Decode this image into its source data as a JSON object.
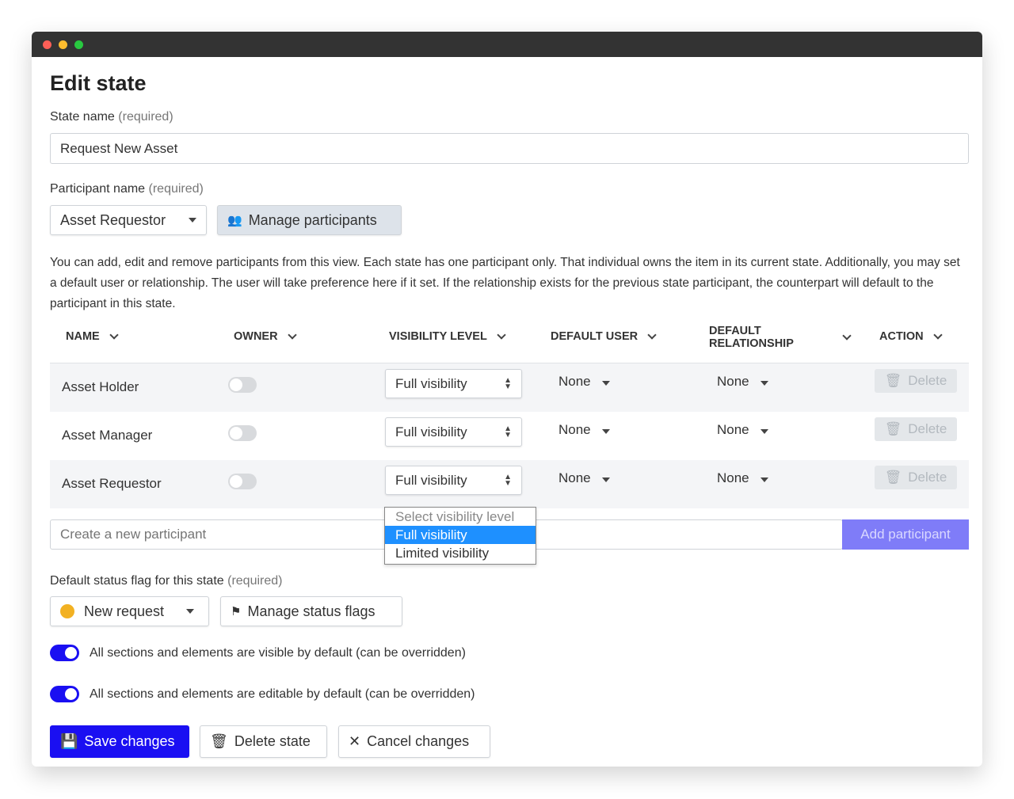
{
  "title": "Edit state",
  "state_name": {
    "label": "State name",
    "required": "(required)",
    "value": "Request New Asset"
  },
  "participant": {
    "label": "Participant name",
    "required": "(required)",
    "selected": "Asset Requestor",
    "manage_button": "Manage participants"
  },
  "description": "You can add, edit and remove participants from this view. Each state has one participant only. That individual owns the item in its current state. Additionally, you may set a default user or relationship. The user will take preference here if it set. If the relationship exists for the previous state participant, the counterpart will default to the participant in this state.",
  "table": {
    "headers": [
      "NAME",
      "OWNER",
      "VISIBILITY LEVEL",
      "DEFAULT USER",
      "DEFAULT RELATIONSHIP",
      "ACTION"
    ],
    "rows": [
      {
        "name": "Asset Holder",
        "owner": false,
        "visibility": "Full visibility",
        "default_user": "None",
        "default_relationship": "None",
        "action": "Delete"
      },
      {
        "name": "Asset Manager",
        "owner": false,
        "visibility": "Full visibility",
        "default_user": "None",
        "default_relationship": "None",
        "action": "Delete"
      },
      {
        "name": "Asset Requestor",
        "owner": false,
        "visibility": "Full visibility",
        "default_user": "None",
        "default_relationship": "None",
        "action": "Delete"
      }
    ]
  },
  "visibility_dropdown": {
    "options": [
      "Select visibility level",
      "Full visibility",
      "Limited visibility"
    ],
    "highlighted": "Full visibility"
  },
  "new_participant": {
    "placeholder": "Create a new participant",
    "add_button": "Add participant"
  },
  "status_flag": {
    "label": "Default status flag for this state",
    "required": "(required)",
    "selected": "New request",
    "flag_color": "#f2b122",
    "manage_button": "Manage status flags"
  },
  "toggles": [
    {
      "label": "All sections and elements are visible by default (can be overridden)",
      "on": true
    },
    {
      "label": "All sections and elements are editable by default (can be overridden)",
      "on": true
    }
  ],
  "actions": {
    "save": "Save changes",
    "delete": "Delete state",
    "cancel": "Cancel changes"
  },
  "colors": {
    "primary": "#1a0ff2",
    "add_button": "#7f7cf8",
    "highlight": "#1e90ff"
  }
}
